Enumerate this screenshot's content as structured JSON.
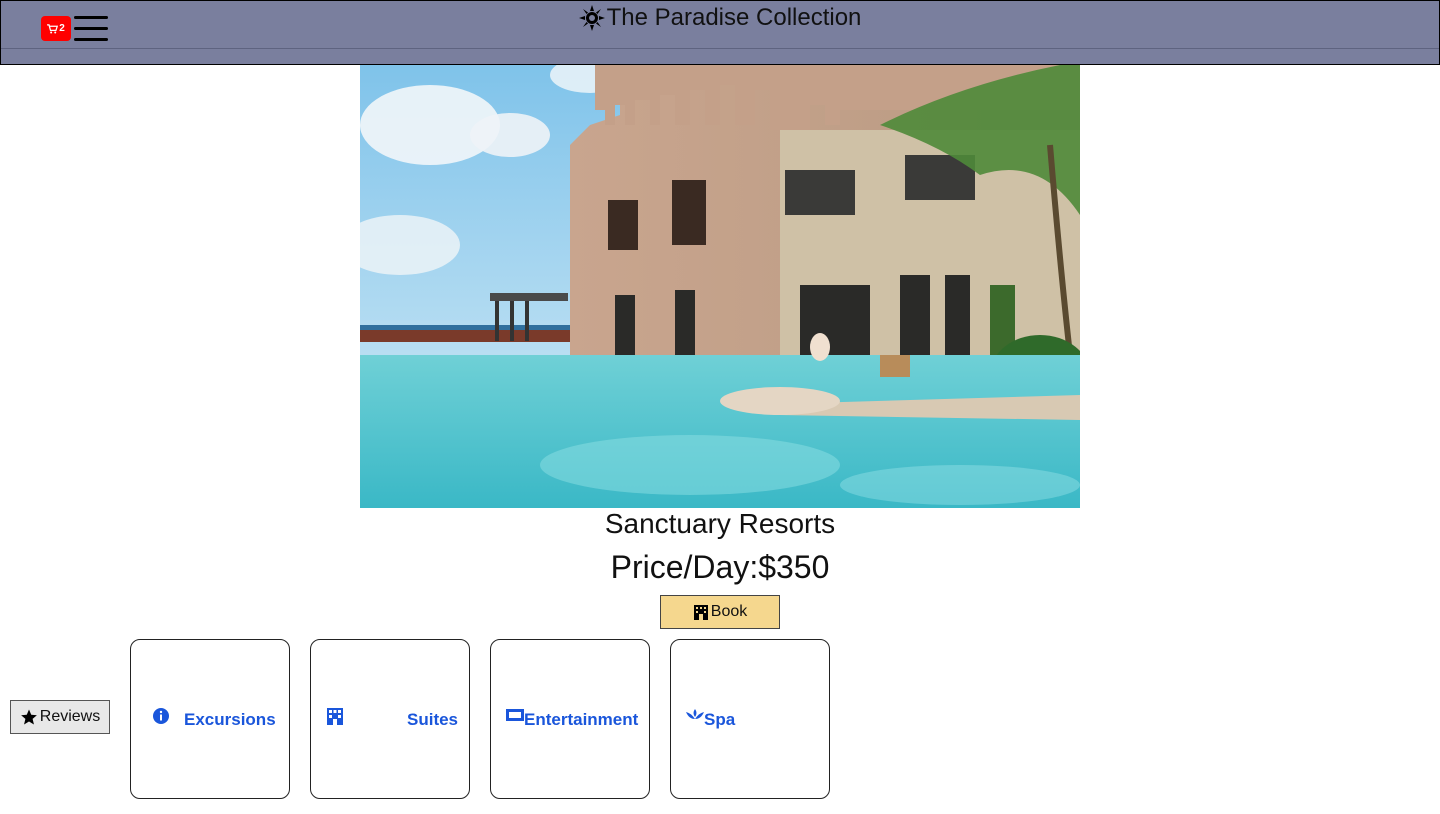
{
  "header": {
    "brand_title": "The Paradise Collection",
    "cart_count": "2"
  },
  "hero": {
    "title": "Sanctuary Resorts",
    "price": "Price/Day:$350",
    "book_label": "Book"
  },
  "reviews_label": "Reviews",
  "cards": [
    {
      "label": "Excursions",
      "icon": "info-icon"
    },
    {
      "label": "Suites",
      "icon": "building-icon"
    },
    {
      "label": "Entertainment",
      "icon": "ticket-icon"
    },
    {
      "label": "Spa",
      "icon": "spa-icon"
    }
  ],
  "colors": {
    "header_bg": "#7a7f9e",
    "cart_badge": "#ff0000",
    "book_button": "#f5d78e",
    "link_blue": "#1a56db"
  }
}
